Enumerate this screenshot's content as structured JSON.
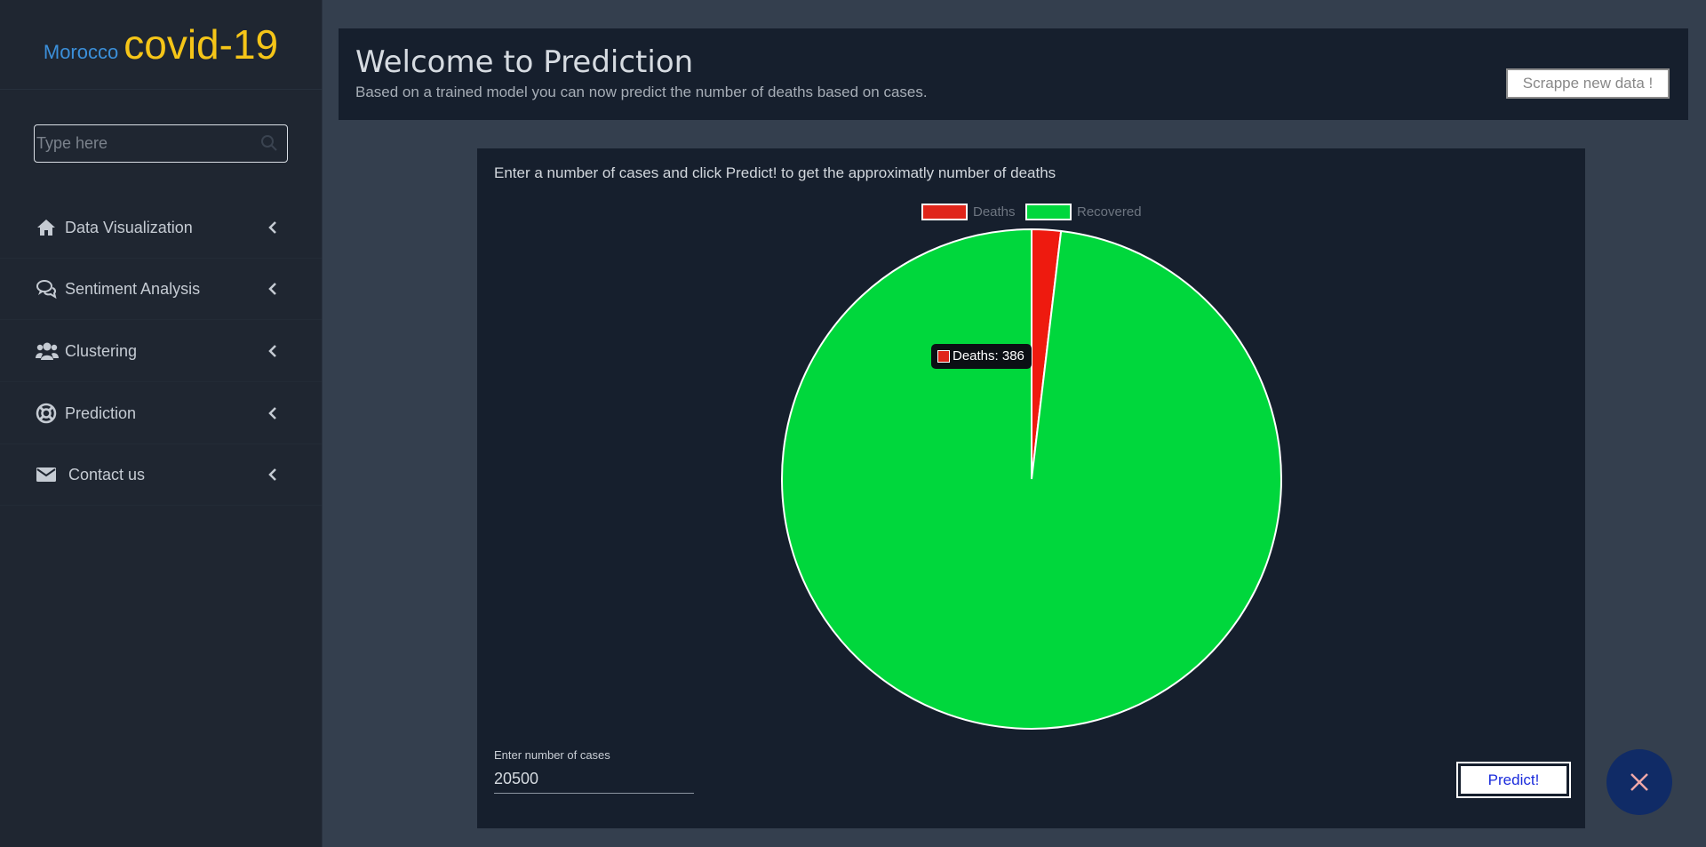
{
  "sidebar": {
    "brand_small": "Morocco",
    "brand_big": "covid-19",
    "search_placeholder": "Type here",
    "items": [
      {
        "label": "Data Visualization",
        "icon": "home-icon"
      },
      {
        "label": "Sentiment Analysis",
        "icon": "comments-icon"
      },
      {
        "label": "Clustering",
        "icon": "users-icon"
      },
      {
        "label": "Prediction",
        "icon": "life-ring-icon"
      },
      {
        "label": "Contact us",
        "icon": "envelope-icon"
      }
    ]
  },
  "header": {
    "title": "Welcome to Prediction",
    "subtitle": "Based on a trained model you can now predict the number of deaths based on cases.",
    "scrape_label": "Scrappe new data !"
  },
  "panel": {
    "instruction": "Enter a number of cases and click Predict! to get the approximatly number of deaths",
    "cases_label": "Enter number of cases",
    "cases_value": "20500",
    "predict_label": "Predict!"
  },
  "tooltip": {
    "text": "Deaths: 386"
  },
  "colors": {
    "deaths": "#ee1a0f",
    "recovered": "#00d73c",
    "brand_small": "#3b8fd9",
    "brand_big": "#f5c518"
  },
  "chart_data": {
    "type": "pie",
    "categories": [
      "Deaths",
      "Recovered"
    ],
    "values": [
      386,
      20114
    ],
    "legend_position": "top",
    "legend": [
      "Deaths",
      "Recovered"
    ]
  }
}
